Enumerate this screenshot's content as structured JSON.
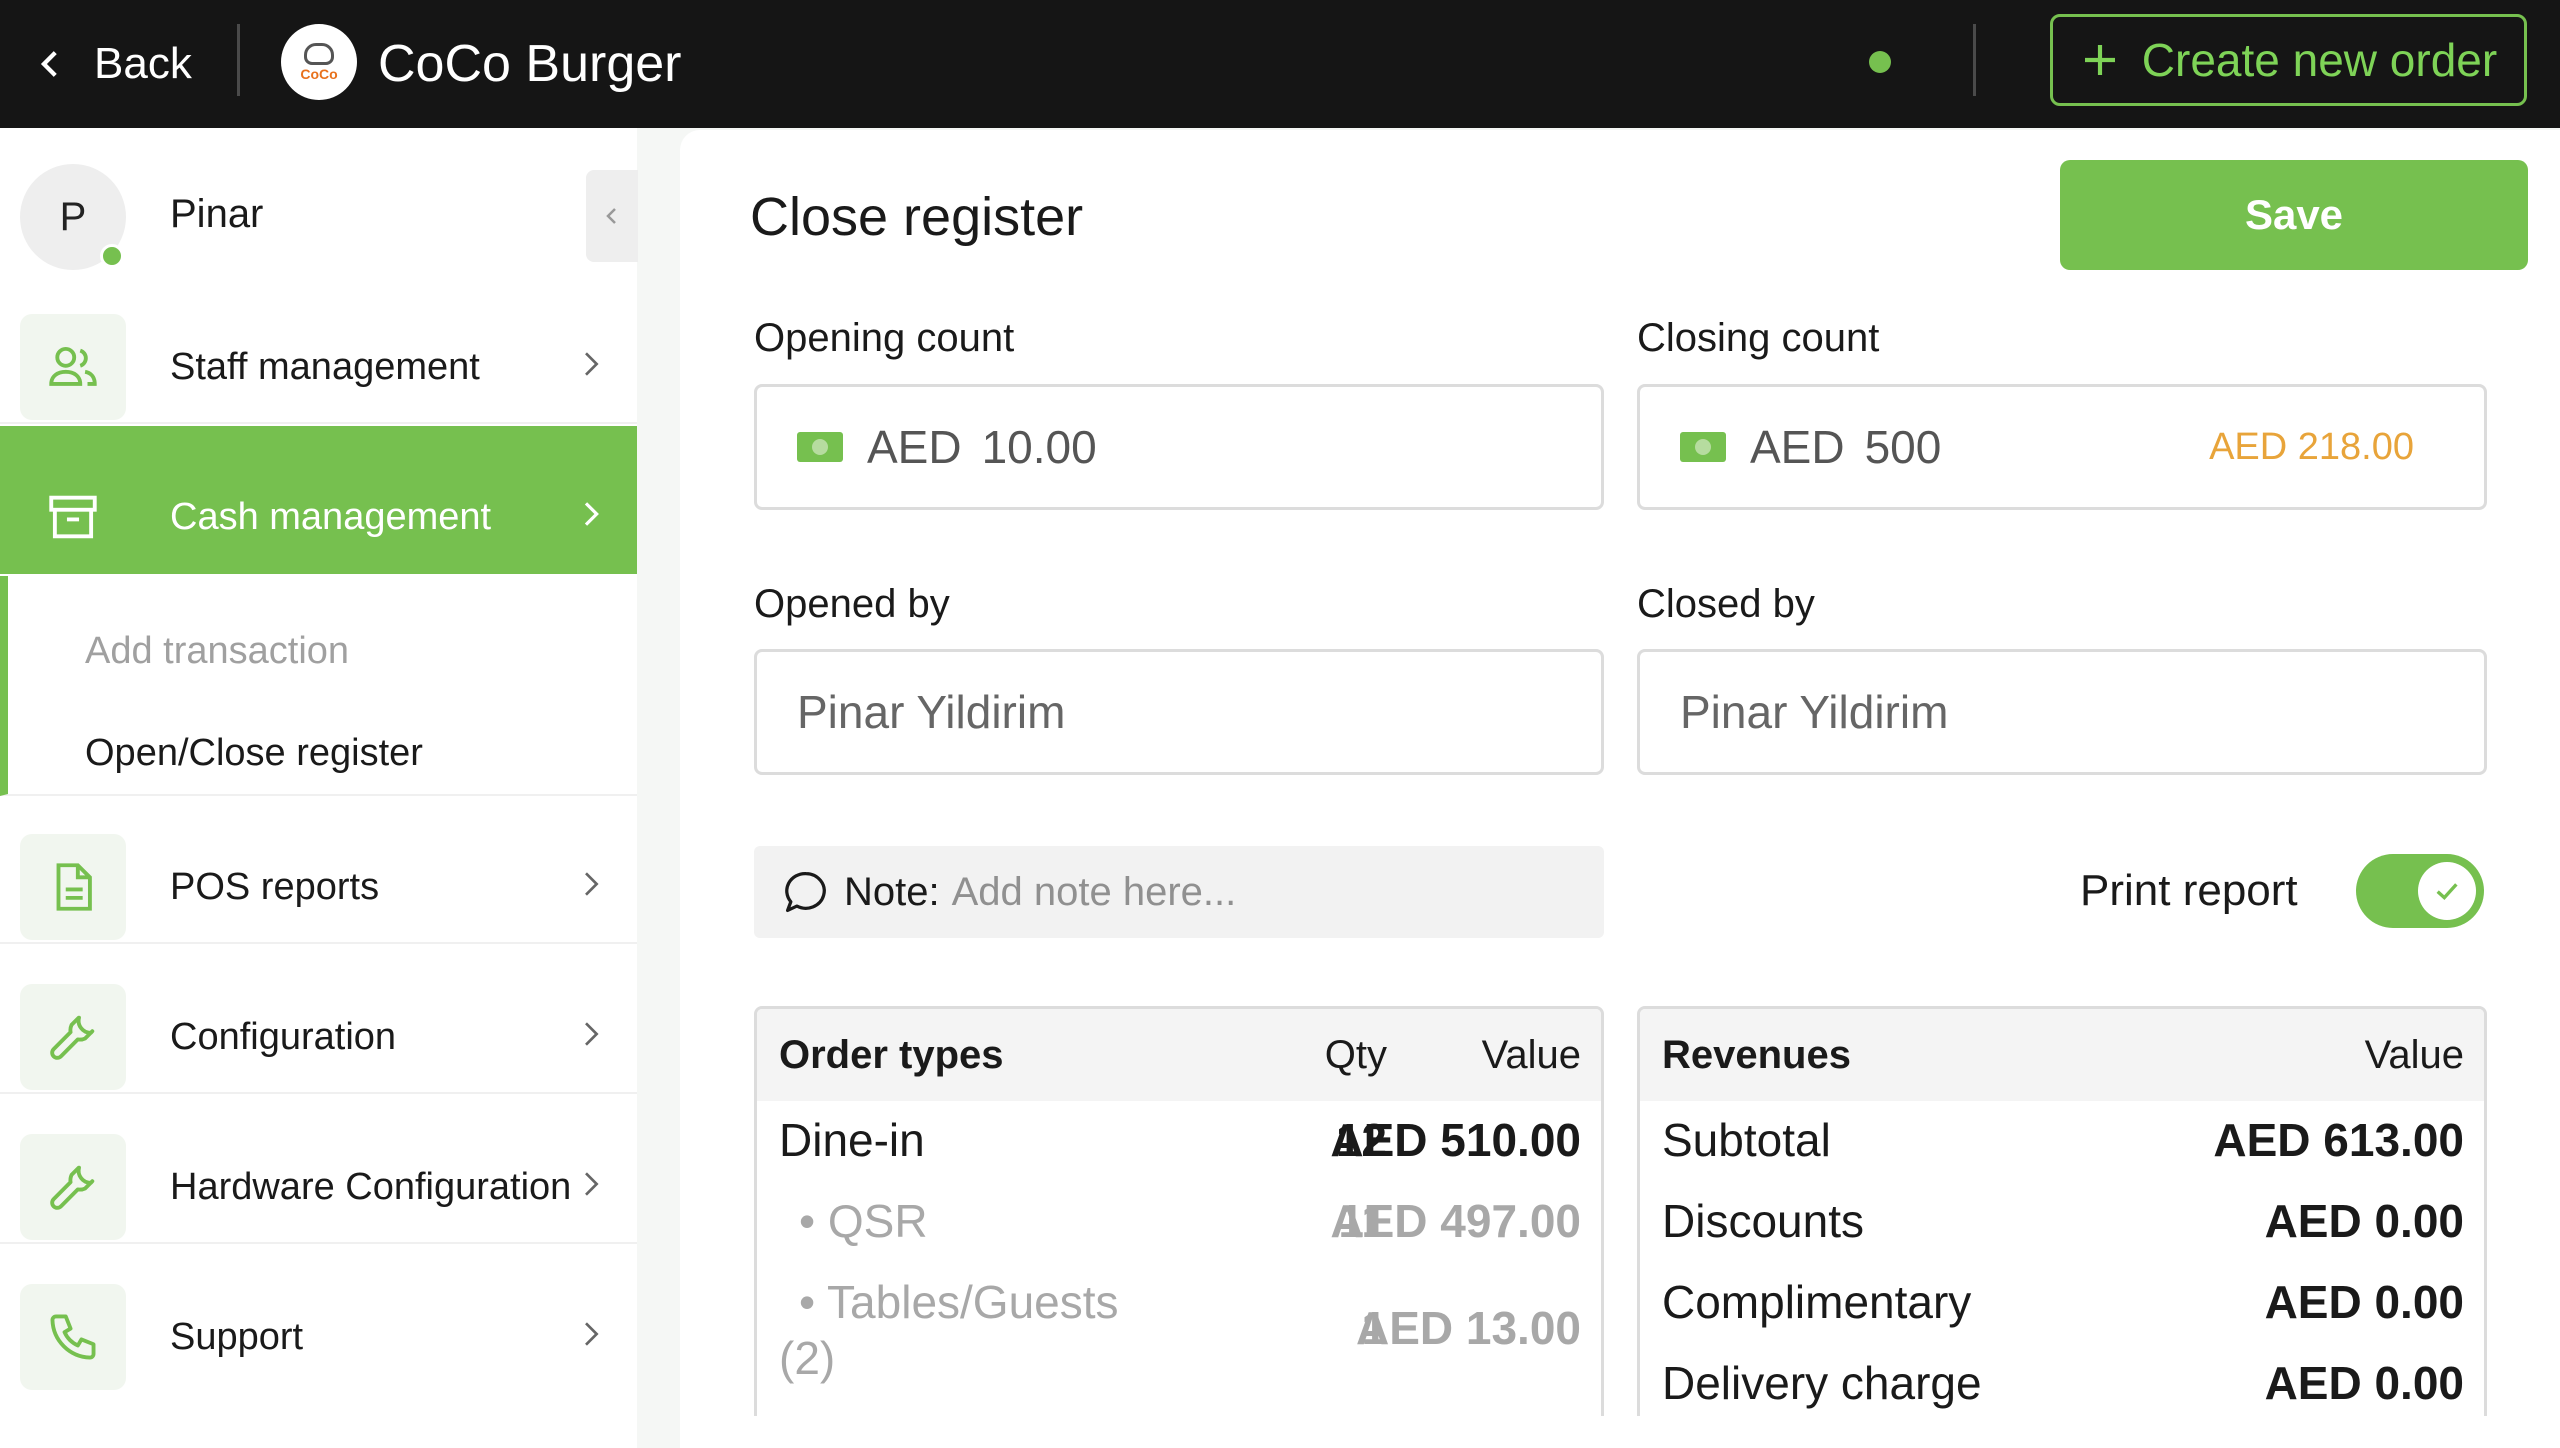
{
  "header": {
    "back_label": "Back",
    "logo_text": "CoCo",
    "brand": "CoCo Burger",
    "create_order_label": "Create new order"
  },
  "sidebar": {
    "user_initial": "P",
    "user_name": "Pinar",
    "items": [
      {
        "label": "Staff management",
        "icon": "staff-icon"
      },
      {
        "label": "Cash management",
        "icon": "cash-drawer-icon",
        "active": true
      },
      {
        "label": "POS reports",
        "icon": "document-icon"
      },
      {
        "label": "Configuration",
        "icon": "wrench-icon"
      },
      {
        "label": "Hardware Configuration",
        "icon": "wrench-icon"
      },
      {
        "label": "Support",
        "icon": "phone-icon"
      }
    ],
    "subitems": [
      "Add transaction",
      "Open/Close register"
    ]
  },
  "main": {
    "title": "Close register",
    "save_label": "Save",
    "opening": {
      "label": "Opening count",
      "currency": "AED",
      "value": "10.00"
    },
    "closing": {
      "label": "Closing count",
      "currency": "AED",
      "value": "500",
      "expected": "AED 218.00"
    },
    "opened_by": {
      "label": "Opened by",
      "value": "Pinar Yildirim"
    },
    "closed_by": {
      "label": "Closed by",
      "value": "Pinar Yildirim"
    },
    "note": {
      "label": "Note:",
      "placeholder": "Add note here..."
    },
    "print_report": {
      "label": "Print report",
      "enabled": true
    },
    "order_types": {
      "headers": [
        "Order types",
        "Qty",
        "Value"
      ],
      "rows": [
        {
          "name": "Dine-in",
          "qty": "12",
          "value": "AED 510.00"
        },
        {
          "name": "• QSR",
          "qty": "11",
          "value": "AED 497.00"
        },
        {
          "name": "• Tables/Guests",
          "name2": "(2)",
          "qty": "1",
          "value": "AED 13.00"
        }
      ]
    },
    "revenues": {
      "headers": [
        "Revenues",
        "Value"
      ],
      "rows": [
        {
          "name": "Subtotal",
          "value": "AED 613.00"
        },
        {
          "name": "Discounts",
          "value": "AED 0.00"
        },
        {
          "name": "Complimentary",
          "value": "AED 0.00"
        },
        {
          "name": "Delivery charge",
          "value": "AED 0.00"
        }
      ]
    }
  },
  "colors": {
    "accent": "#76c04f",
    "topbar": "#151515",
    "warning": "#e8a43a"
  }
}
